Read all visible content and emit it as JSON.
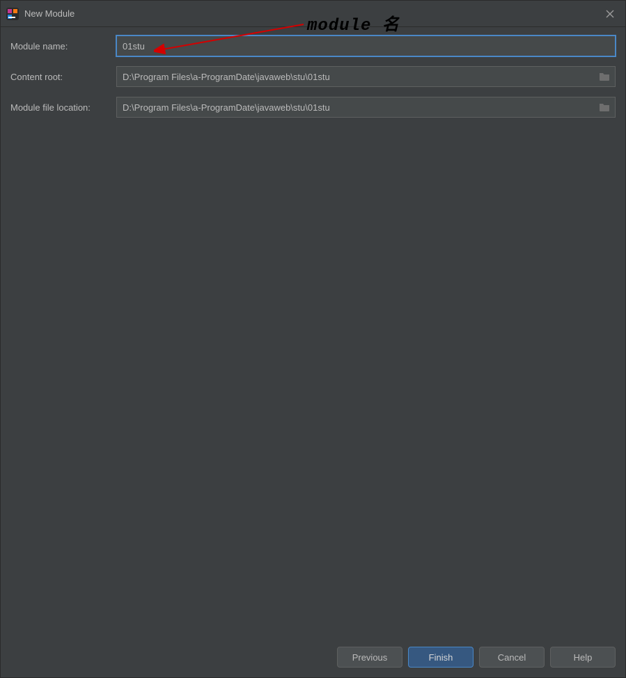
{
  "titlebar": {
    "title": "New Module"
  },
  "form": {
    "module_name": {
      "label": "Module name:",
      "value": "01stu"
    },
    "content_root": {
      "label": "Content root:",
      "value": "D:\\Program Files\\a-ProgramDate\\javaweb\\stu\\01stu"
    },
    "module_file_location": {
      "label": "Module file location:",
      "value": "D:\\Program Files\\a-ProgramDate\\javaweb\\stu\\01stu"
    }
  },
  "buttons": {
    "previous": "Previous",
    "finish": "Finish",
    "cancel": "Cancel",
    "help": "Help"
  },
  "annotation": {
    "label": "module 名"
  }
}
